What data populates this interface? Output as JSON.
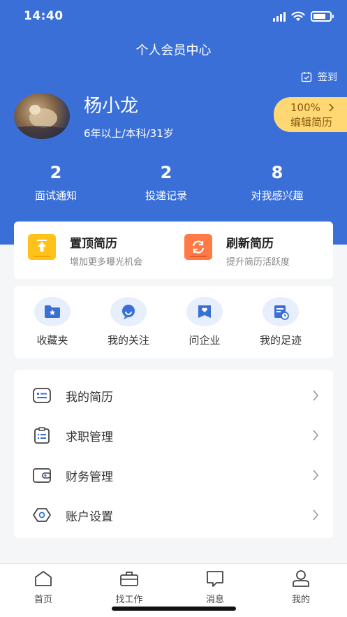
{
  "status_bar": {
    "time": "14:40"
  },
  "header": {
    "title": "个人会员中心",
    "checkin_label": "签到"
  },
  "profile": {
    "name": "杨小龙",
    "info": "6年以上/本科/31岁",
    "completion": "100%",
    "edit_label": "编辑简历"
  },
  "stats": [
    {
      "value": "2",
      "label": "面试通知"
    },
    {
      "value": "2",
      "label": "投递记录"
    },
    {
      "value": "8",
      "label": "对我感兴趣"
    }
  ],
  "promos": [
    {
      "title": "置顶简历",
      "subtitle": "增加更多曝光机会",
      "icon": "pin-top-icon",
      "color": "#ffc21a"
    },
    {
      "title": "刷新简历",
      "subtitle": "提升简历活跃度",
      "icon": "refresh-icon",
      "color": "#ff7a45"
    }
  ],
  "quick_actions": [
    {
      "label": "收藏夹",
      "icon": "favorites-folder-icon"
    },
    {
      "label": "我的关注",
      "icon": "follow-icon"
    },
    {
      "label": "问企业",
      "icon": "ask-company-icon"
    },
    {
      "label": "我的足迹",
      "icon": "history-icon"
    }
  ],
  "menu": [
    {
      "label": "我的简历",
      "icon": "resume-icon"
    },
    {
      "label": "求职管理",
      "icon": "clipboard-icon"
    },
    {
      "label": "财务管理",
      "icon": "wallet-icon"
    },
    {
      "label": "账户设置",
      "icon": "settings-icon"
    }
  ],
  "tabbar": [
    {
      "label": "首页",
      "icon": "home-icon"
    },
    {
      "label": "找工作",
      "icon": "briefcase-icon"
    },
    {
      "label": "消息",
      "icon": "message-icon"
    },
    {
      "label": "我的",
      "icon": "user-icon"
    }
  ],
  "colors": {
    "primary": "#3a6fd8",
    "accent_yellow": "#ffd874",
    "icon_blue": "#3a6fd8"
  }
}
